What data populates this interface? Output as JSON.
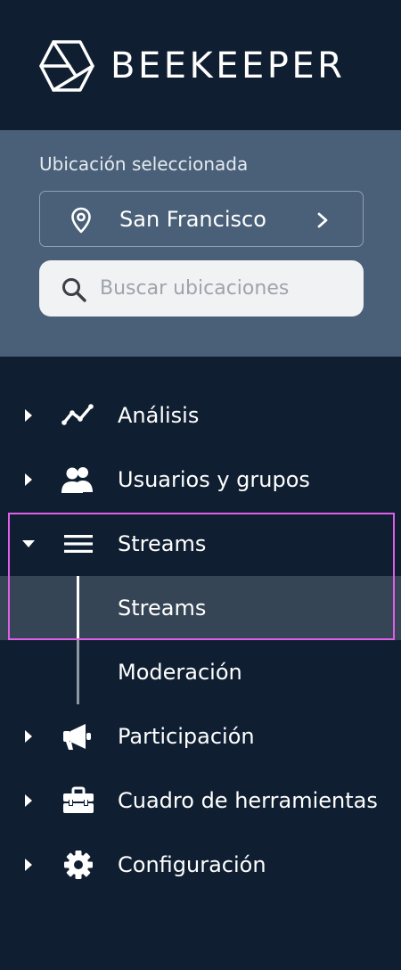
{
  "brand": {
    "name": "BEEKEEPER"
  },
  "location": {
    "label": "Ubicación seleccionada",
    "selected": "San Francisco",
    "search_placeholder": "Buscar ubicaciones",
    "search_value": ""
  },
  "nav": {
    "items": [
      {
        "label": "Análisis",
        "icon": "analytics-line-icon",
        "expanded": false
      },
      {
        "label": "Usuarios y grupos",
        "icon": "users-icon",
        "expanded": false
      },
      {
        "label": "Streams",
        "icon": "menu-lines-icon",
        "expanded": true
      },
      {
        "label": "Participación",
        "icon": "megaphone-icon",
        "expanded": false
      },
      {
        "label": "Cuadro de herramientas",
        "icon": "toolbox-icon",
        "expanded": false
      },
      {
        "label": "Configuración",
        "icon": "gear-icon",
        "expanded": false
      }
    ],
    "streams_children": [
      {
        "label": "Streams",
        "active": true
      },
      {
        "label": "Moderación",
        "active": false
      }
    ]
  },
  "colors": {
    "sidebar_bg": "#0f1f31",
    "location_panel_bg": "#4a6078",
    "active_row_bg": "#354555",
    "highlight_outline": "#e05ee8"
  }
}
